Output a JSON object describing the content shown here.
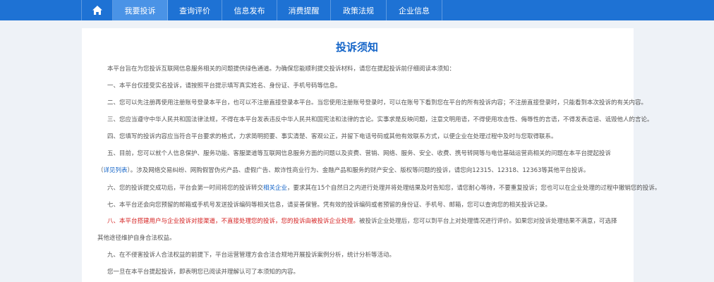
{
  "nav": {
    "items": [
      {
        "label": "我要投诉",
        "active": true
      },
      {
        "label": "查询评价",
        "active": false
      },
      {
        "label": "信息发布",
        "active": false
      },
      {
        "label": "消费提醒",
        "active": false
      },
      {
        "label": "政策法规",
        "active": false
      },
      {
        "label": "企业信息",
        "active": false
      }
    ]
  },
  "colors": {
    "nav_bg": "#1e72d4",
    "nav_active": "#4a93e6",
    "title": "#1565c8",
    "warning_red": "#d42020",
    "page_bg": "#eef2f7"
  },
  "notice": {
    "title": "投诉须知",
    "intro": "本平台旨在为您投诉互联网信息服务相关的问题提供绿色通道。为确保您能顺利提交投诉材料，请您在提起投诉前仔细阅读本须知：",
    "p1": "一、本平台仅接受实名投诉，请按照平台提示填写真实姓名、身份证、手机号码等信息。",
    "p2": "二、您可以先注册再使用注册账号登录本平台，也可以不注册直接登录本平台。当您使用注册账号登录时，可以在账号下看到您在平台的所有投诉内容；不注册直接登录时，只能看到本次投诉的有关内容。",
    "p3": "三、您应当遵守中华人民共和国法律法规，不得在本平台发表违反中华人民共和国宪法和法律的言论。实事求是反映问题，注意文明用语，不得使用攻击性、侮辱性的言语，不得发表造谣、诋毁他人的言论。",
    "p4": "四、您填写的投诉内容应当符合平台要求的格式，力求简明扼要、事实清楚、客观公正，并留下电话号码或其他有效联系方式，以便企业在处理过程中及时与您取得联系。",
    "p5a": "五、目前，您可以就个人信息保护、服务功能、客服渠道等互联网信息服务方面的问题以及资费、营销、网络、服务、安全、收费、携号转网等与电信基础运营商相关的问题在本平台提起投诉（",
    "p5link": "详见列表",
    "p5b": "）。涉及网络交易纠纷、网购假冒伪劣产品、虚假广告、欺诈性商业行为、金融产品和服务的财产安全、版权等问题的投诉，请您向12315、12318、12363等其他平台投诉。",
    "p6a": "六、您的投诉提交成功后，平台会第一时间将您的投诉转交",
    "p6link": "相关企业",
    "p6b": "，要求其在15个自然日之内进行处理并将处理结果及时告知您，请您耐心等待，不要重复投诉；您也可以在企业处理的过程中撤销您的投诉。",
    "p7": "七、本平台还会向您预留的邮箱或手机号发送投诉编码等相关信息，请妥善保管。凭有效的投诉编码或者预留的身份证、手机号、邮箱，您可以查询您的相关投诉记录。",
    "p8red": "八、本平台搭建用户与企业投诉对接渠道，不直接处理您的投诉，您的投诉由被投诉企业处理。",
    "p8b": "被投诉企业处理后，您可以到平台上对处理情况进行评价。如果您对投诉处理结果不满意，可选择其他途径维护自身合法权益。",
    "p9": "九、在不侵害投诉人合法权益的前提下，平台运营管理方会合法合规地开展投诉案例分析，统计分析等活动。",
    "closing": "您一旦在本平台提起投诉，即表明您已阅读并理解认可了本须知的内容。"
  }
}
